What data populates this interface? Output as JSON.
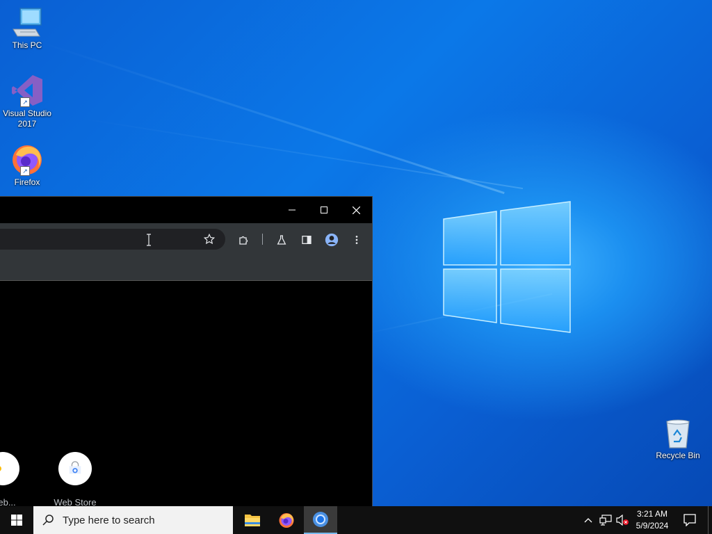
{
  "desktop": {
    "icons": [
      {
        "label_line1": "This PC",
        "label_line2": ""
      },
      {
        "label_line1": "Visual Studio",
        "label_line2": "2017"
      },
      {
        "label_line1": "Firefox",
        "label_line2": ""
      },
      {
        "label_line1": "Recycle Bin",
        "label_line2": ""
      }
    ]
  },
  "browser": {
    "window_controls": {
      "minimize": "—",
      "maximize": "☐",
      "close": "✕"
    },
    "new_tab_tiles": [
      {
        "label": "Web..."
      },
      {
        "label": "Web Store"
      }
    ]
  },
  "taskbar": {
    "search_placeholder": "Type here to search",
    "clock_time": "3:21 AM",
    "clock_date": "5/9/2024"
  },
  "colors": {
    "desktop_blue": "#0a6fe0",
    "taskbar": "#101010",
    "browser_toolbar": "#323639",
    "active_indicator": "#76b9ed"
  }
}
